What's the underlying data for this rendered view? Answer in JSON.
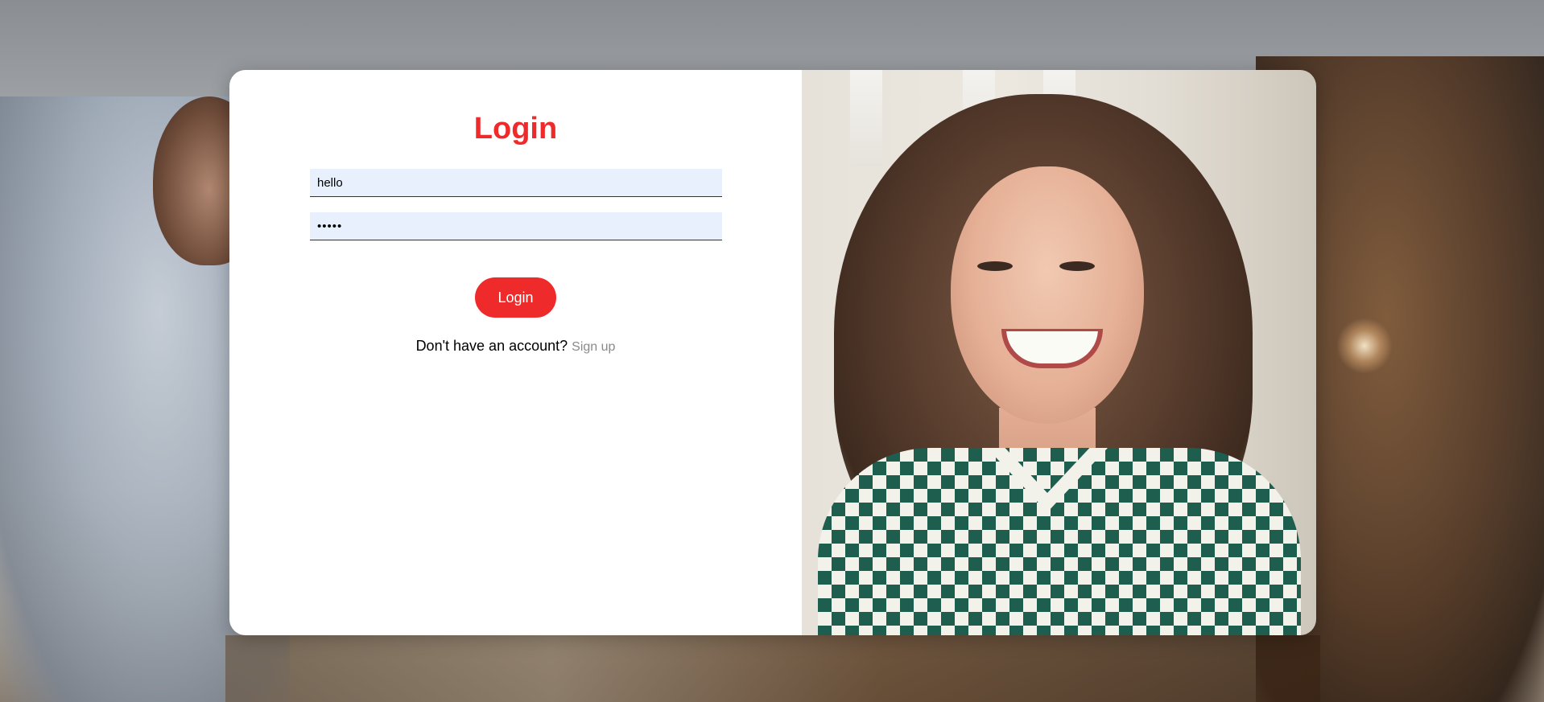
{
  "login": {
    "title": "Login",
    "username_value": "hello",
    "password_value": "hello",
    "submit_label": "Login",
    "signup_prompt": "Don't have an account?",
    "signup_link": "Sign up"
  },
  "colors": {
    "accent": "#ee2a2a",
    "input_background": "#e8f0fe",
    "link_muted": "#8a8a8a"
  }
}
